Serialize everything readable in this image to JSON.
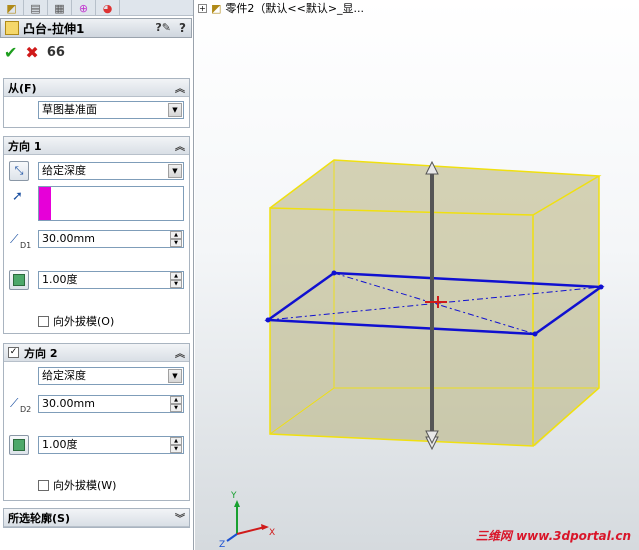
{
  "property_manager": {
    "tabs": [
      "feature-manager-icon",
      "property-manager-icon",
      "configuration-manager-icon",
      "dimxpert-icon",
      "display-manager-icon"
    ],
    "title": "凸台-拉伸1",
    "actions": {
      "ok": "✔",
      "cancel": "✖",
      "preview": "66"
    },
    "from_group": {
      "header": "从(F)",
      "start_condition": "草图基准面"
    },
    "direction1": {
      "header": "方向 1",
      "end_condition": "给定深度",
      "depth": "30.00mm",
      "depth_label": "D1",
      "draft_angle": "1.00度",
      "draft_outward": "向外拔模(O)",
      "color_swatch": "#e600d8"
    },
    "direction2": {
      "header": "方向 2",
      "checked": "✓",
      "end_condition": "给定深度",
      "depth": "30.00mm",
      "depth_label": "D2",
      "draft_angle": "1.00度",
      "draft_outward": "向外拔模(W)"
    },
    "selected_contours": {
      "header": "所选轮廓(S)"
    }
  },
  "viewport": {
    "tree_label": "零件2（默认<<默认>_显...",
    "triad": {
      "x": "X",
      "y": "Y",
      "z": "Z"
    },
    "watermark": "三维网 www.3dportal.cn"
  },
  "colors": {
    "box_edge": "#f0e010",
    "box_fill": "#b6b07a",
    "sketch": "#1010d0",
    "arrow": "#555555",
    "accent": "#d9162a"
  }
}
